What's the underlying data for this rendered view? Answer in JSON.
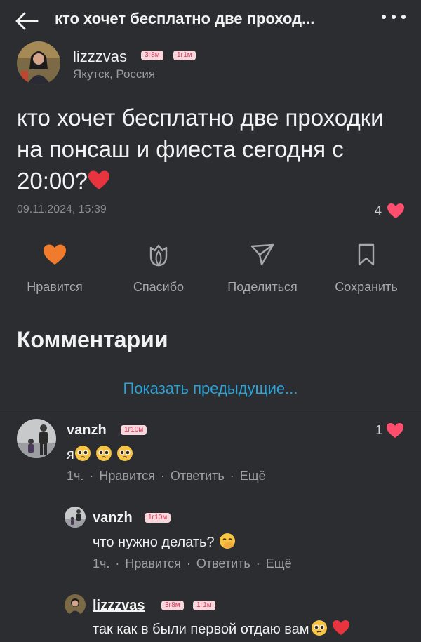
{
  "header": {
    "title": "кто хочет бесплатно две проход..."
  },
  "author": {
    "name": "lizzzvas",
    "badge1": "3г8м",
    "badge2": "1г1м",
    "location": "Якутск, Россия"
  },
  "post": {
    "text": "кто хочет бесплатно две проходки на понсаш и фиеста сегодня с 20:00?",
    "date": "09.11.2024, 15:39",
    "likes": "4"
  },
  "actions": {
    "like": "Нравится",
    "thanks": "Спасибо",
    "share": "Поделиться",
    "save": "Сохранить"
  },
  "comments_section": {
    "title": "Комментарии",
    "show_previous": "Показать предыдущие..."
  },
  "comments": [
    {
      "name": "vanzh",
      "badge": "1г10м",
      "text": "я",
      "likes": "1",
      "time": "1ч.",
      "like": "Нравится",
      "reply": "Ответить",
      "more": "Ещё"
    },
    {
      "name": "vanzh",
      "badge": "1г10м",
      "text": "что нужно делать?",
      "time": "1ч.",
      "like": "Нравится",
      "reply": "Ответить",
      "more": "Ещё"
    },
    {
      "name": "lizzzvas",
      "badge1": "3г8м",
      "badge2": "1г1м",
      "text": "так как в были первой отдаю вам"
    }
  ],
  "colors": {
    "background": "#2b2d31",
    "accent_like": "#f07b2c",
    "heart": "#ff4d6d",
    "link": "#2aa3d6"
  },
  "icons": [
    "back-arrow-icon",
    "more-dots-icon",
    "heart-icon",
    "tulip-icon",
    "send-icon",
    "bookmark-icon"
  ]
}
